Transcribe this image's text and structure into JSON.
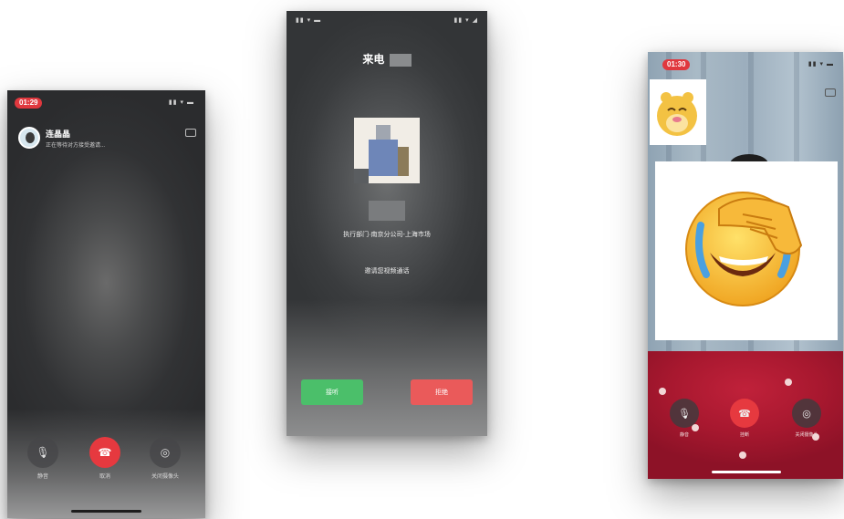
{
  "phone1": {
    "time": "01:29",
    "status": "▮▮ ▾ ▬",
    "caller_name": "连晶晶",
    "subtitle": "正在等待对方接受邀请...",
    "controls": [
      {
        "icon": "mute-icon",
        "glyph": "🎙",
        "label": "静音"
      },
      {
        "icon": "hangup-icon",
        "glyph": "☎",
        "label": "取消"
      },
      {
        "icon": "camera-icon",
        "glyph": "◎",
        "label": "关闭摄像头"
      }
    ]
  },
  "phone2": {
    "status": "▮▮ ▾ ◢",
    "title": "来电",
    "org": "执行部门·南京分公司-上海市场",
    "invite": "邀请您视频通话",
    "answer_label": "接听",
    "decline_label": "拒绝"
  },
  "phone3": {
    "time": "01:30",
    "status": "▮▮ ▾ ▬",
    "controls": [
      {
        "icon": "mute-icon",
        "glyph": "🎙",
        "label": "静音"
      },
      {
        "icon": "hangup-icon",
        "glyph": "☎",
        "label": "挂断"
      },
      {
        "icon": "camera-icon",
        "glyph": "◎",
        "label": "关闭摄像头"
      }
    ]
  },
  "colors": {
    "hangup": "#e6393f",
    "answer": "#4bbf6a",
    "decline": "#ea5a5a",
    "time_pill": "#e0383e"
  }
}
